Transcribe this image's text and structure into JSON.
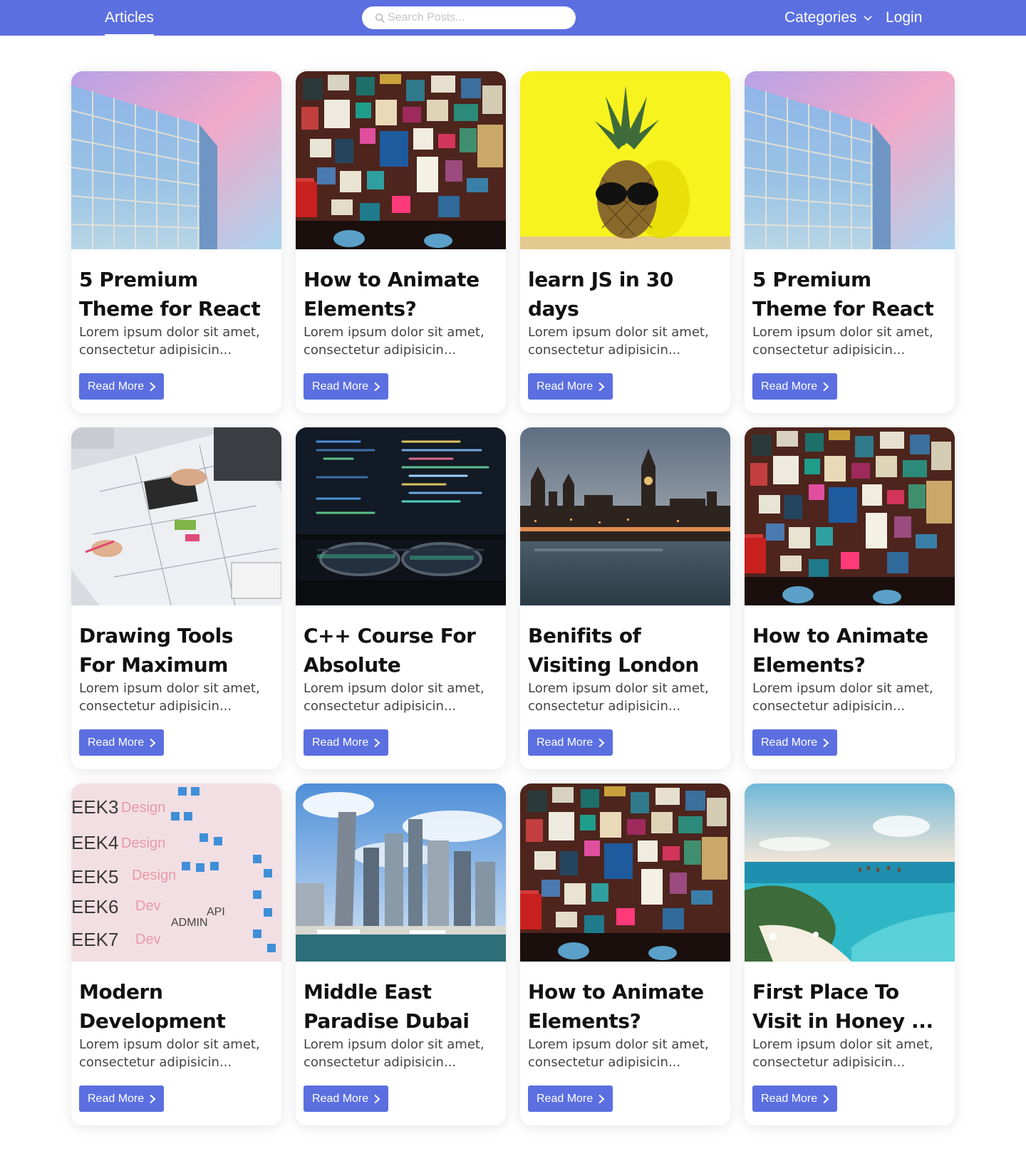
{
  "nav": {
    "brand": "Articles",
    "search_placeholder": "Search Posts...",
    "categories_label": "Categories",
    "login_label": "Login"
  },
  "colors": {
    "accent": "#5b6fe0"
  },
  "cards": [
    {
      "title": "5 Premium Theme for React",
      "excerpt": "Lorem ipsum dolor sit amet, consectetur adipisicin...",
      "button": "Read More",
      "image": "building"
    },
    {
      "title": "How to Animate Elements?",
      "excerpt": "Lorem ipsum dolor sit amet, consectetur adipisicin...",
      "button": "Read More",
      "image": "wall"
    },
    {
      "title": "learn JS in 30 days",
      "excerpt": "Lorem ipsum dolor sit amet, consectetur adipisicin...",
      "button": "Read More",
      "image": "pineapple"
    },
    {
      "title": "5 Premium Theme for React",
      "excerpt": "Lorem ipsum dolor sit amet, consectetur adipisicin...",
      "button": "Read More",
      "image": "building"
    },
    {
      "title": "Drawing Tools For Maximum Prod...",
      "excerpt": "Lorem ipsum dolor sit amet, consectetur adipisicin...",
      "button": "Read More",
      "image": "drawing"
    },
    {
      "title": "C++ Course For Absolute Beginn...",
      "excerpt": "Lorem ipsum dolor sit amet, consectetur adipisicin...",
      "button": "Read More",
      "image": "code"
    },
    {
      "title": "Benifits of Visiting London",
      "excerpt": "Lorem ipsum dolor sit amet, consectetur adipisicin...",
      "button": "Read More",
      "image": "london"
    },
    {
      "title": "How to Animate Elements?",
      "excerpt": "Lorem ipsum dolor sit amet, consectetur adipisicin...",
      "button": "Read More",
      "image": "wall"
    },
    {
      "title": "Modern Development Tech",
      "excerpt": "Lorem ipsum dolor sit amet, consectetur adipisicin...",
      "button": "Read More",
      "image": "whiteboard"
    },
    {
      "title": "Middle East Paradise Dubai",
      "excerpt": "Lorem ipsum dolor sit amet, consectetur adipisicin...",
      "button": "Read More",
      "image": "dubai"
    },
    {
      "title": "How to Animate Elements?",
      "excerpt": "Lorem ipsum dolor sit amet, consectetur adipisicin...",
      "button": "Read More",
      "image": "wall"
    },
    {
      "title": "First Place To Visit in Honey ...",
      "excerpt": "Lorem ipsum dolor sit amet, consectetur adipisicin...",
      "button": "Read More",
      "image": "beach"
    }
  ]
}
